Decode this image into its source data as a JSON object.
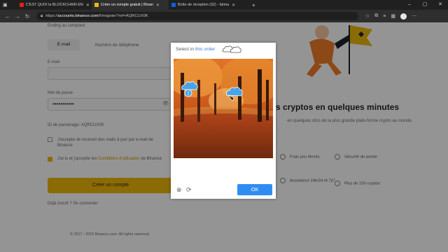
{
  "browser": {
    "tabs": [
      {
        "title": "C'EST QUOI la BLOCKCHAIN EN",
        "favicon_color": "#e62117",
        "active": false
      },
      {
        "title": "Créer un compte gratuit | Binan",
        "favicon_color": "#f0b90b",
        "active": true
      },
      {
        "title": "Boîte de réception (32) - fatma",
        "favicon_color": "#0a64d6",
        "active": false
      }
    ],
    "new_tab_label": "+",
    "window_controls": {
      "minimize": "–",
      "maximize": "▢",
      "close": "✕"
    },
    "url": {
      "prefix": "https://",
      "host": "accounts.binance.com",
      "path": "/fr/register?ref=AQRCUX0K"
    },
    "nav": {
      "back": "←",
      "forward": "→",
      "reload": "↻"
    }
  },
  "page": {
    "subtitle": "Ending au comptant",
    "tabs": {
      "email": "E-mail",
      "phone": "Numéro de téléphone"
    },
    "email_label": "E-mail",
    "password_label": "Mot de passe",
    "password_value": "•••••••••••",
    "referral": "ID de parrainage: AQRCUX0K",
    "checkbox_updates": "J'accepte de recevoir des mails à jour par e-mail de Binance",
    "checkbox_terms_prefix": "J'ai lu et j'accepte les",
    "checkbox_terms_link": "Conditions d'utilisation",
    "checkbox_terms_suffix": "de Binance",
    "create_button": "Créer un compte",
    "login_prompt": "Déjà inscrit ? Se connecter",
    "footer": "© 2017 - 2022 Binance.com. All rights reserved",
    "right_title": "tez des cryptos en quelques minutes",
    "right_subtitle": "en quelques clics de la plus grande plate-forme crypto au monde.",
    "features": [
      {
        "label": "Frais peu élevés"
      },
      {
        "label": "Sécurité de pointe"
      },
      {
        "label": "Assistance 24h/24 et 7j/7"
      },
      {
        "label": "Plus de 150 cryptos"
      }
    ]
  },
  "captcha": {
    "instruction_prefix": "Select in",
    "instruction_highlight": "this order",
    "ok_label": "OK",
    "close_icon": "close-icon",
    "refresh_icon": "refresh-icon",
    "marker_1": "1",
    "colors": {
      "accent": "#2f8df2",
      "marker": "#4aa3e6"
    }
  }
}
